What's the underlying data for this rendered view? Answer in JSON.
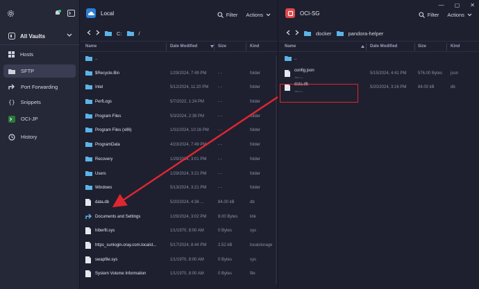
{
  "sidebar": {
    "vault_label": "All Vaults",
    "items": [
      {
        "label": "Hosts",
        "icon": "hosts-grid-icon"
      },
      {
        "label": "SFTP",
        "icon": "folder-icon"
      },
      {
        "label": "Port Forwarding",
        "icon": "port-forwarding-icon"
      },
      {
        "label": "Snippets",
        "icon": "braces-icon"
      },
      {
        "label": "OCI-JP",
        "icon": "terminal-icon"
      },
      {
        "label": "History",
        "icon": "clock-icon"
      }
    ]
  },
  "left_pane": {
    "title": "Local",
    "filter_label": "Filter",
    "actions_label": "Actions",
    "path": [
      "C:",
      "/"
    ],
    "columns": {
      "name": "Name",
      "date": "Date Modified",
      "size": "Size",
      "kind": "Kind"
    },
    "rows": [
      {
        "name": "..",
        "date": "",
        "size": "",
        "kind": "",
        "type": "folder"
      },
      {
        "name": "$Recycle.Bin",
        "date": "1/29/2024, 7:49 PM",
        "size": "- -",
        "kind": "folder",
        "type": "folder"
      },
      {
        "name": "Intel",
        "date": "5/12/2024, 11:20 PM",
        "size": "- -",
        "kind": "folder",
        "type": "folder"
      },
      {
        "name": "PerfLogs",
        "date": "5/7/2022, 1:24 PM",
        "size": "- -",
        "kind": "folder",
        "type": "folder"
      },
      {
        "name": "Program Files",
        "date": "5/3/2024, 2:39 PM",
        "size": "- -",
        "kind": "folder",
        "type": "folder"
      },
      {
        "name": "Program Files (x86)",
        "date": "1/31/2024, 10:16 PM",
        "size": "- -",
        "kind": "folder",
        "type": "folder"
      },
      {
        "name": "ProgramData",
        "date": "4/23/2024, 7:49 PM",
        "size": "- -",
        "kind": "folder",
        "type": "folder"
      },
      {
        "name": "Recovery",
        "date": "1/29/2024, 3:01 PM",
        "size": "- -",
        "kind": "folder",
        "type": "folder"
      },
      {
        "name": "Users",
        "date": "1/29/2024, 3:21 PM",
        "size": "- -",
        "kind": "folder",
        "type": "folder"
      },
      {
        "name": "Windows",
        "date": "5/13/2024, 3:21 PM",
        "size": "- -",
        "kind": "folder",
        "type": "folder"
      },
      {
        "name": "data.db",
        "date": "5/20/2024, 4:36 ...",
        "size": "84.00 kB",
        "kind": "db",
        "type": "file"
      },
      {
        "name": "Documents and Settings",
        "date": "1/29/2024, 3:02 PM",
        "size": "8.00 Bytes",
        "kind": "link",
        "type": "link"
      },
      {
        "name": "hiberfil.sys",
        "date": "1/1/1970, 8:00 AM",
        "size": "0 Bytes",
        "kind": "sys",
        "type": "file"
      },
      {
        "name": "https_sunlogin.oray.com.localst...",
        "date": "5/17/2024, 8:44 PM",
        "size": "2.52 kB",
        "kind": "localstorage",
        "type": "file"
      },
      {
        "name": "swapfile.sys",
        "date": "1/1/1970, 8:00 AM",
        "size": "0 Bytes",
        "kind": "sys",
        "type": "file"
      },
      {
        "name": "System Volume Information",
        "date": "1/1/1970, 8:00 AM",
        "size": "0 Bytes",
        "kind": "file",
        "type": "file"
      }
    ]
  },
  "right_pane": {
    "title": "OCI-SG",
    "filter_label": "Filter",
    "actions_label": "Actions",
    "path": [
      "docker",
      "pandora-helper"
    ],
    "columns": {
      "name": "Name",
      "date": "Date Modified",
      "size": "Size",
      "kind": "Kind"
    },
    "rows": [
      {
        "name": "..",
        "date": "",
        "size": "",
        "kind": "",
        "type": "folder",
        "sub": ""
      },
      {
        "name": "config.json",
        "date": "5/15/2024, 4:41 PM",
        "size": "576.00 Bytes",
        "kind": "json",
        "type": "file",
        "sub": "-rw-r--r--"
      },
      {
        "name": "data.db",
        "date": "5/20/2024, 3:16 PM",
        "size": "84.00 kB",
        "kind": "db",
        "type": "file",
        "sub": "-rw-r--r--"
      }
    ]
  },
  "colors": {
    "accent_red": "#e0262e",
    "folder_blue": "#5bb4e8",
    "local_badge": "#2b7fd4",
    "remote_badge": "#e04848"
  }
}
